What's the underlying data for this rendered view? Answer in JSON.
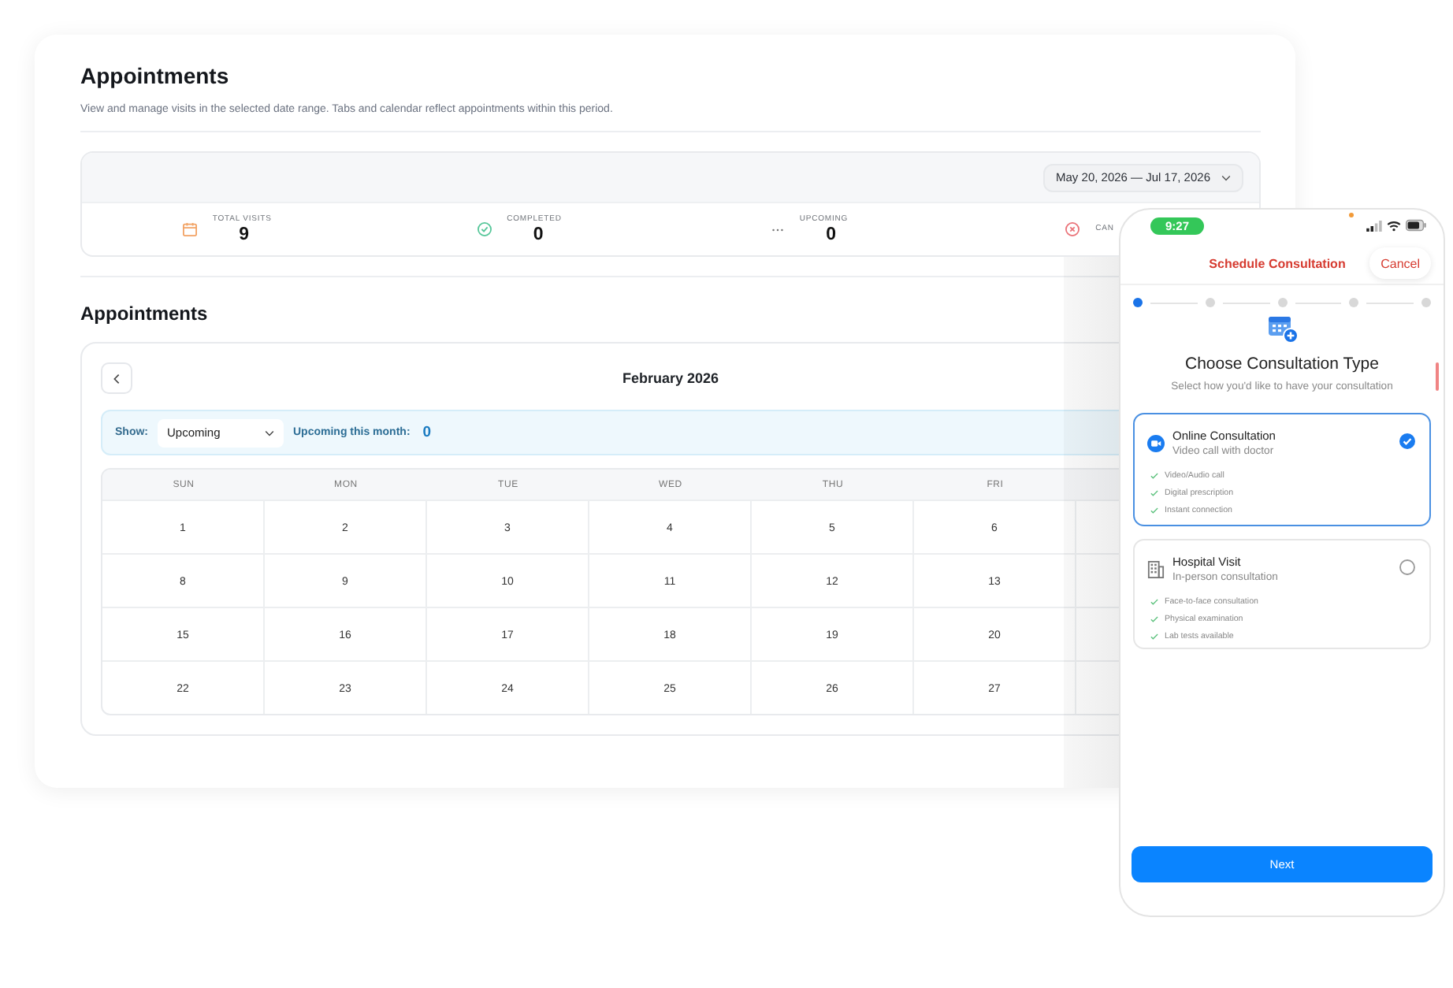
{
  "page": {
    "title": "Appointments",
    "subtitle": "View and manage visits in the selected date range. Tabs and calendar reflect appointments within this period."
  },
  "date_range": {
    "value": "May 20, 2026 — Jul 17, 2026"
  },
  "stats": [
    {
      "kind": "calendar",
      "label": "TOTAL VISITS",
      "value": "9"
    },
    {
      "kind": "check",
      "label": "COMPLETED",
      "value": "0"
    },
    {
      "kind": "dots",
      "label": "UPCOMING",
      "value": "0"
    },
    {
      "kind": "cancel",
      "label": "CAN"
    }
  ],
  "section": {
    "title": "Appointments"
  },
  "calendar": {
    "month": "February 2026",
    "filter": {
      "label": "Show:",
      "value": "Upcoming"
    },
    "count": {
      "label": "Upcoming this month:",
      "value": "0"
    },
    "weekdays": [
      "SUN",
      "MON",
      "TUE",
      "WED",
      "THU",
      "FRI"
    ],
    "weeks": [
      [
        "1",
        "2",
        "3",
        "4",
        "5",
        "6"
      ],
      [
        "8",
        "9",
        "10",
        "11",
        "12",
        "13"
      ],
      [
        "15",
        "16",
        "17",
        "18",
        "19",
        "20"
      ],
      [
        "22",
        "23",
        "24",
        "25",
        "26",
        "27"
      ]
    ]
  },
  "phone": {
    "status_bar": {
      "time": "9:27"
    },
    "header": {
      "title": "Schedule Consultation",
      "cancel": "Cancel"
    },
    "steps": [
      {
        "active": true
      },
      {
        "active": false
      },
      {
        "active": false
      },
      {
        "active": false
      },
      {
        "active": false
      }
    ],
    "heading": "Choose Consultation Type",
    "subheading": "Select how you'd like to have your consultation",
    "options": [
      {
        "kind": "video",
        "title": "Online Consultation",
        "subtitle": "Video call with doctor",
        "selected": true,
        "features": [
          "Video/Audio call",
          "Digital prescription",
          "Instant connection"
        ]
      },
      {
        "kind": "building",
        "title": "Hospital Visit",
        "subtitle": "In-person consultation",
        "selected": false,
        "features": [
          "Face-to-face consultation",
          "Physical examination",
          "Lab tests available"
        ]
      }
    ],
    "next_button": "Next"
  }
}
